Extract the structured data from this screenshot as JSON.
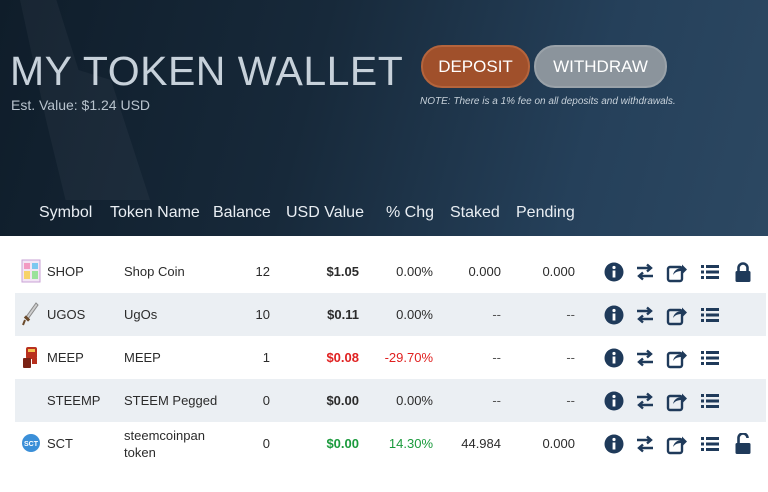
{
  "header": {
    "title": "MY TOKEN WALLET",
    "est_value": "Est. Value: $1.24 USD",
    "deposit_label": "DEPOSIT",
    "withdraw_label": "WITHDRAW",
    "note": "NOTE: There is a 1% fee on all deposits and withdrawals."
  },
  "columns": {
    "symbol": "Symbol",
    "token_name": "Token Name",
    "balance": "Balance",
    "usd_value": "USD Value",
    "pct_chg": "% Chg",
    "staked": "Staked",
    "pending": "Pending"
  },
  "rows": [
    {
      "symbol": "SHOP",
      "name": "Shop Coin",
      "name2": "",
      "balance": "12",
      "usd": "$1.05",
      "chg": "0.00%",
      "staked": "0.000",
      "pending": "0.000"
    },
    {
      "symbol": "UGOS",
      "name": "UgOs",
      "name2": "",
      "balance": "10",
      "usd": "$0.11",
      "chg": "0.00%",
      "staked": "--",
      "pending": "--"
    },
    {
      "symbol": "MEEP",
      "name": "MEEP",
      "name2": "",
      "balance": "1",
      "usd": "$0.08",
      "chg": "-29.70%",
      "staked": "--",
      "pending": "--"
    },
    {
      "symbol": "STEEMP",
      "name": "STEEM Pegged",
      "name2": "",
      "balance": "0",
      "usd": "$0.00",
      "chg": "0.00%",
      "staked": "--",
      "pending": "--"
    },
    {
      "symbol": "SCT",
      "name": "steemcoinpan",
      "name2": "token",
      "balance": "0",
      "usd": "$0.00",
      "chg": "14.30%",
      "staked": "44.984",
      "pending": "0.000"
    }
  ],
  "icons": {
    "info": "info-circle-icon",
    "transfer": "transfer-arrows-icon",
    "share": "share-icon",
    "history": "list-icon",
    "lock": "lock-icon",
    "unlock": "unlock-icon",
    "sct_badge": "SCT"
  },
  "colors": {
    "deposit": "#a0502b",
    "withdraw": "#8b949c",
    "negative": "#e02020",
    "positive": "#1a9a3c",
    "icon": "#1f3a5a"
  }
}
